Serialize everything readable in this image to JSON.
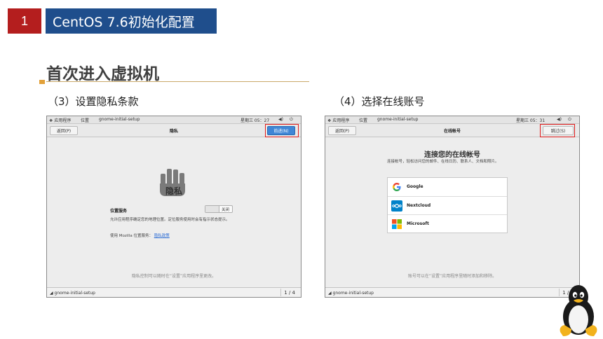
{
  "slide": {
    "section_number": "1",
    "section_title": "CentOS 7.6初始化配置",
    "heading": "首次进入虚拟机",
    "step3_title": "（3）设置隐私条款",
    "step4_title": "（4）选择在线账号"
  },
  "topbar": {
    "apps": "应用程序",
    "places": "位置",
    "app_name": "gnome-initial-setup",
    "clock_left": "星期三 05：27",
    "clock_right": "星期三 05：31"
  },
  "privacy_window": {
    "back_label": "返回(P)",
    "header_title": "隐私",
    "next_label": "前进(N)",
    "page_title": "隐私",
    "location_label": "位置服务",
    "toggle_state": "关闭",
    "description": "允许应用程序确定您的地理位置。定位服务使用时会有指示状态提示。",
    "mozilla_text": "使用 Mozilla 位置服务：",
    "mozilla_link": "隐私政策",
    "footnote": "隐私控制可以随时在“设置”应用程序里更改。",
    "taskbar_item": "gnome-initial-setup",
    "pager": "1 / 4"
  },
  "accounts_window": {
    "back_label": "返回(P)",
    "header_title": "在线帐号",
    "skip_label": "跳过(S)",
    "page_title": "连接您的在线帐号",
    "description": "连接帐号，轻松访问您的邮件、在线日历、联系人、文档和照片。",
    "accounts": [
      {
        "name": "Google",
        "icon": "google-icon"
      },
      {
        "name": "Nextcloud",
        "icon": "nextcloud-icon"
      },
      {
        "name": "Microsoft",
        "icon": "microsoft-icon"
      }
    ],
    "footnote": "账号可以在“设置”应用程序里随时添加和移除。",
    "taskbar_item": "gnome-initial-setup",
    "pager": "1 / 4"
  },
  "colors": {
    "section_number_bg": "#b41e1e",
    "section_title_bg": "#1f4e8c",
    "highlight": "#e01a1a",
    "primary_button": "#3f86d6"
  }
}
